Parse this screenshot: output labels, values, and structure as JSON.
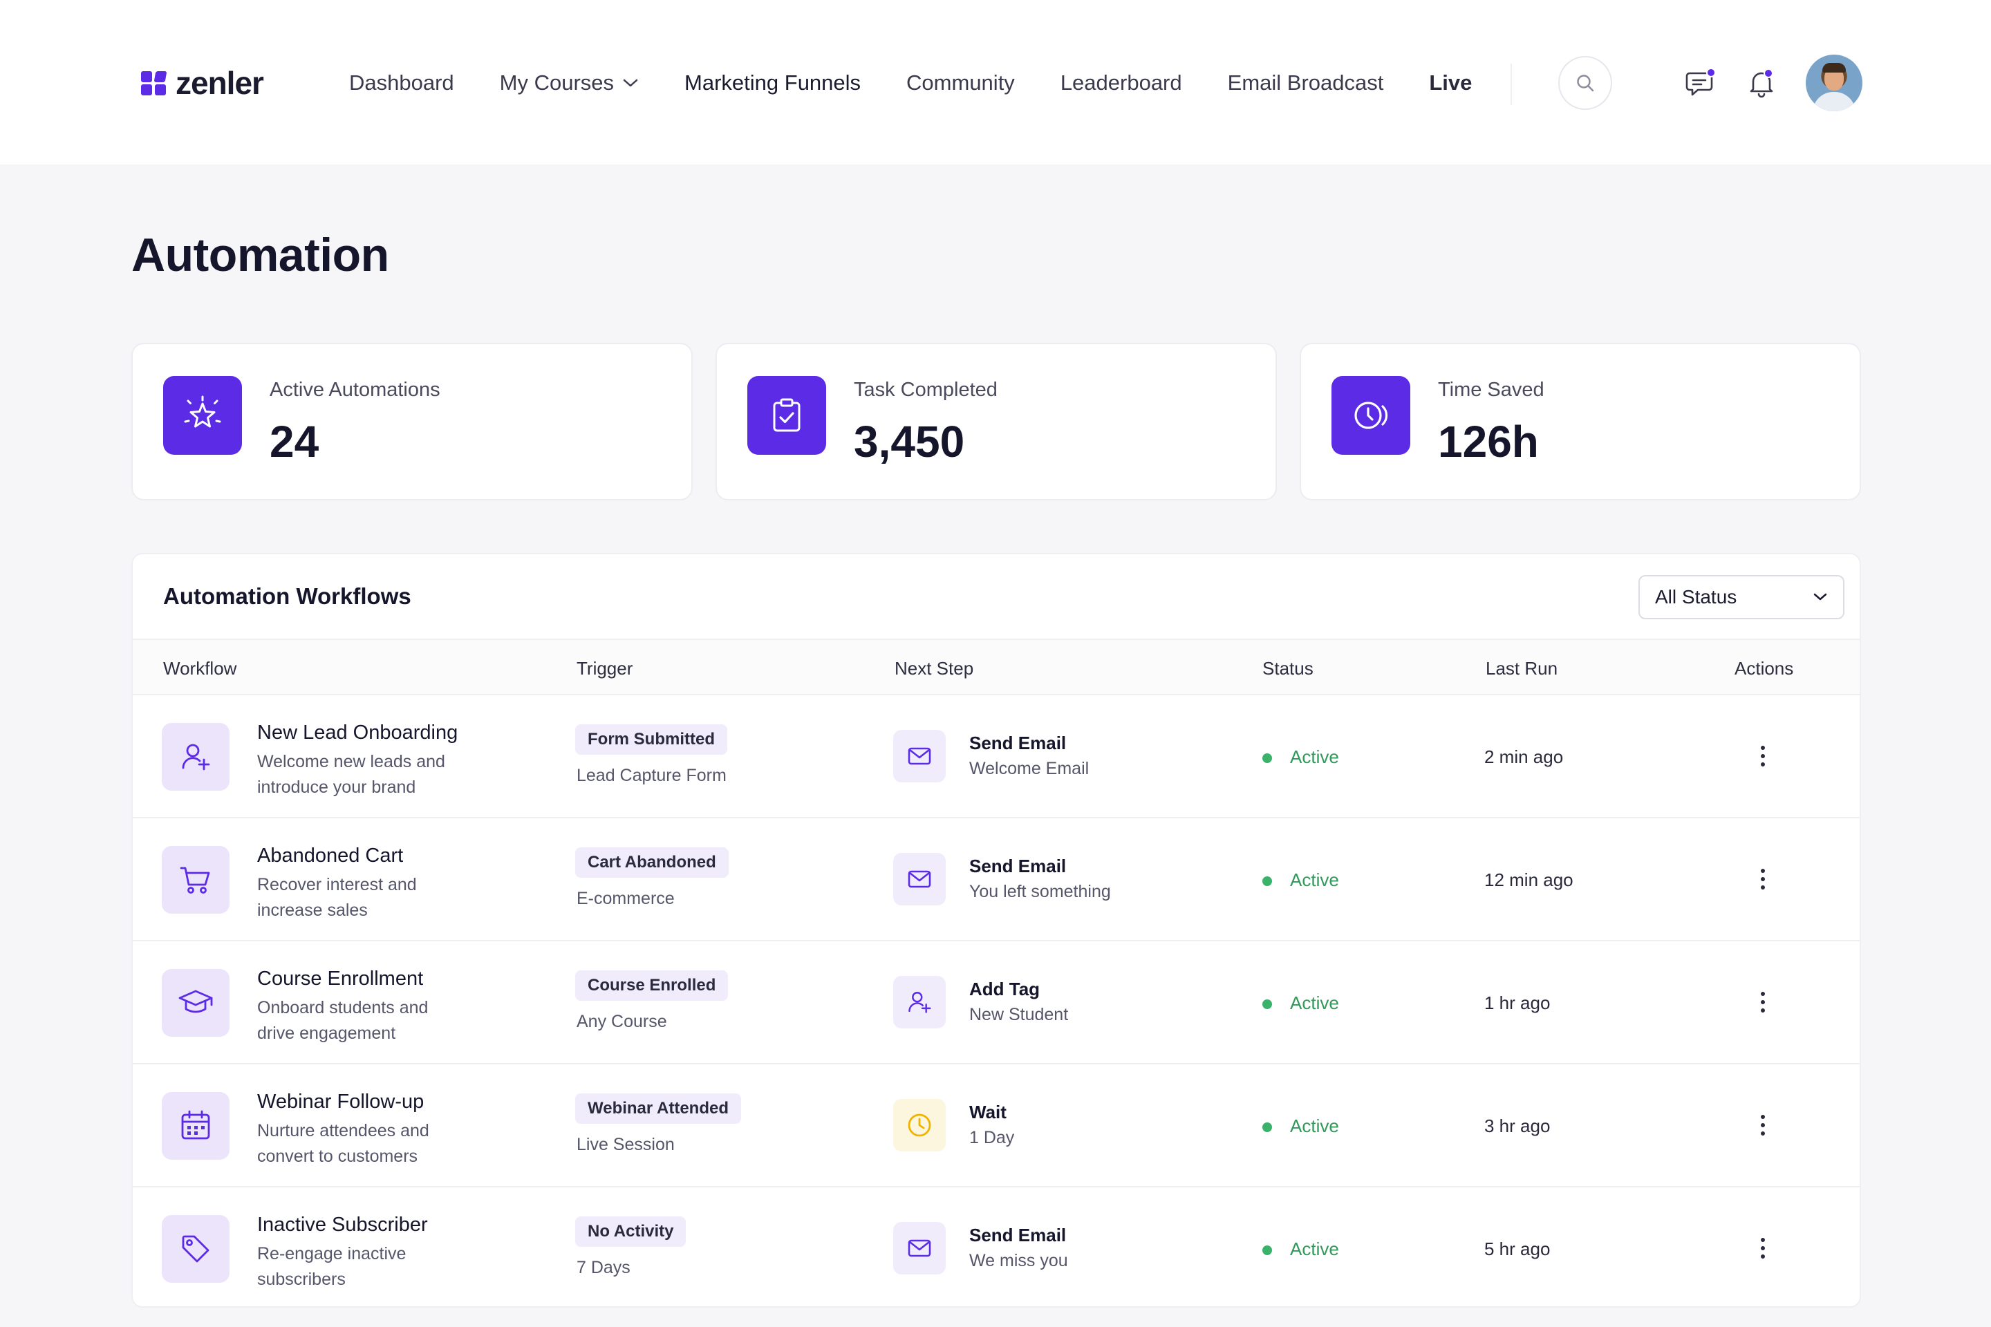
{
  "brand": {
    "name": "zenler",
    "accent": "#5b2be6"
  },
  "nav": {
    "items": [
      {
        "label": "Dashboard"
      },
      {
        "label": "My Courses"
      },
      {
        "label": "Marketing Funnels"
      },
      {
        "label": "Community"
      },
      {
        "label": "Leaderboard"
      },
      {
        "label": "Email Broadcast"
      },
      {
        "label": "Live"
      }
    ],
    "icons": [
      "search-icon",
      "chat-icon",
      "bell-icon",
      "avatar"
    ]
  },
  "page": {
    "title": "Automation"
  },
  "stats": [
    {
      "label": "Active Automations",
      "value": "24",
      "icon": "sparkle-star-icon"
    },
    {
      "label": "Task Completed",
      "value": "3,450",
      "icon": "clipboard-check-icon"
    },
    {
      "label": "Time Saved",
      "value": "126h",
      "icon": "clock-icon"
    }
  ],
  "workflows": {
    "title": "Automation Workflows",
    "filter": {
      "selected": "All Status"
    },
    "columns": [
      "Workflow",
      "Trigger",
      "Next Step",
      "Status",
      "Last Run",
      "Actions"
    ],
    "rows": [
      {
        "icon": "user-plus-icon",
        "name": "New Lead Onboarding",
        "desc": "Welcome new leads and introduce your brand",
        "trigger": "Form Submitted",
        "trigger_sub": "Lead Capture Form",
        "step_icon": "mail-icon",
        "step": "Send Email",
        "step_sub": "Welcome Email",
        "status": "Active",
        "last_run": "2 min ago"
      },
      {
        "icon": "cart-icon",
        "name": "Abandoned Cart",
        "desc": "Recover interest and increase sales",
        "trigger": "Cart Abandoned",
        "trigger_sub": "E-commerce",
        "step_icon": "mail-icon",
        "step": "Send Email",
        "step_sub": "You left something",
        "status": "Active",
        "last_run": "12 min ago"
      },
      {
        "icon": "graduation-cap-icon",
        "name": "Course Enrollment",
        "desc": "Onboard students and drive engagement",
        "trigger": "Course Enrolled",
        "trigger_sub": "Any Course",
        "step_icon": "user-plus-icon",
        "step": "Add Tag",
        "step_sub": "New Student",
        "status": "Active",
        "last_run": "1 hr ago"
      },
      {
        "icon": "calendar-icon",
        "name": "Webinar Follow-up",
        "desc": "Nurture attendees and convert to customers",
        "trigger": "Webinar Attended",
        "trigger_sub": "Live Session",
        "step_icon": "clock-icon",
        "step": "Wait",
        "step_sub": "1 Day",
        "status": "Active",
        "last_run": "3 hr ago"
      },
      {
        "icon": "tag-icon",
        "name": "Inactive Subscriber",
        "desc": "Re-engage inactive subscribers",
        "trigger": "No Activity",
        "trigger_sub": "7 Days",
        "step_icon": "mail-icon",
        "step": "Send Email",
        "step_sub": "We miss you",
        "status": "Active",
        "last_run": "5 hr ago"
      }
    ],
    "status_color": "#3bb26a"
  }
}
